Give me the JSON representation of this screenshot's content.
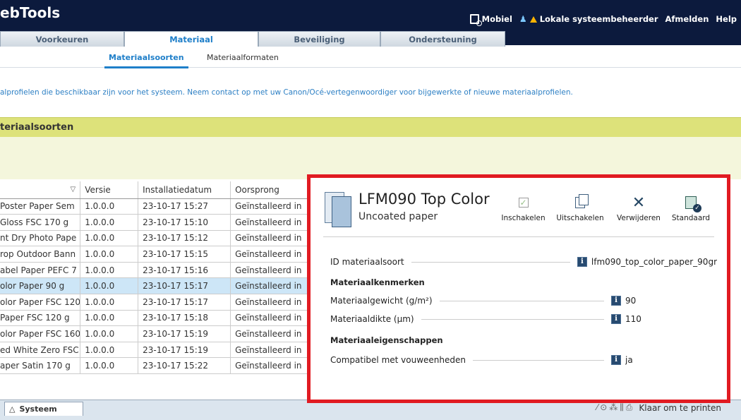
{
  "header": {
    "brand": "ebTools",
    "links": {
      "mobile": "Mobiel",
      "admin": "Lokale systeembeheerder",
      "logout": "Afmelden",
      "help": "Help"
    }
  },
  "main_tabs": [
    "Voorkeuren",
    "Materiaal",
    "Beveiliging",
    "Ondersteuning"
  ],
  "sub_tabs": [
    "Materiaalsoorten",
    "Materiaalformaten"
  ],
  "info_text": "alprofielen die beschikbaar zijn voor het systeem. Neem contact op met uw Canon/Océ-vertegenwoordiger voor bijgewerkte of nieuwe materiaalprofielen.",
  "section": {
    "title": "teriaalsoorten"
  },
  "table": {
    "columns": [
      "",
      "Versie",
      "Installatiedatum",
      "Oorsprong"
    ],
    "rows": [
      {
        "name": "Poster Paper Sem",
        "version": "1.0.0.0",
        "date": "23-10-17 15:27",
        "origin": "Geïnstalleerd in"
      },
      {
        "name": "Gloss FSC 170 g",
        "version": "1.0.0.0",
        "date": "23-10-17 15:10",
        "origin": "Geïnstalleerd in"
      },
      {
        "name": "nt Dry Photo Pape",
        "version": "1.0.0.0",
        "date": "23-10-17 15:12",
        "origin": "Geïnstalleerd in"
      },
      {
        "name": "rop Outdoor Bann",
        "version": "1.0.0.0",
        "date": "23-10-17 15:15",
        "origin": "Geïnstalleerd in"
      },
      {
        "name": "abel Paper PEFC 7",
        "version": "1.0.0.0",
        "date": "23-10-17 15:16",
        "origin": "Geïnstalleerd in"
      },
      {
        "name": "olor Paper 90 g",
        "version": "1.0.0.0",
        "date": "23-10-17 15:17",
        "origin": "Geïnstalleerd in"
      },
      {
        "name": "olor Paper FSC 120",
        "version": "1.0.0.0",
        "date": "23-10-17 15:17",
        "origin": "Geïnstalleerd in"
      },
      {
        "name": "Paper FSC 120 g",
        "version": "1.0.0.0",
        "date": "23-10-17 15:18",
        "origin": "Geïnstalleerd in"
      },
      {
        "name": "olor Paper FSC 160",
        "version": "1.0.0.0",
        "date": "23-10-17 15:19",
        "origin": "Geïnstalleerd in"
      },
      {
        "name": "ed White Zero FSC",
        "version": "1.0.0.0",
        "date": "23-10-17 15:19",
        "origin": "Geïnstalleerd in"
      },
      {
        "name": "aper Satin 170 g",
        "version": "1.0.0.0",
        "date": "23-10-17 15:22",
        "origin": "Geïnstalleerd in"
      }
    ],
    "selected_index": 5
  },
  "footer": {
    "system_tab": "Systeem",
    "status": "Klaar om te printen"
  },
  "detail": {
    "title": "LFM090 Top Color",
    "subtitle": "Uncoated paper",
    "actions": {
      "enable": "Inschakelen",
      "disable": "Uitschakelen",
      "delete": "Verwijderen",
      "default": "Standaard"
    },
    "id_label": "ID materiaalsoort",
    "id_value": "lfm090_top_color_paper_90gr",
    "group1": "Materiaalkenmerken",
    "weight_label": "Materiaalgewicht (g/m²)",
    "weight_value": "90",
    "thickness_label": "Materiaaldikte (µm)",
    "thickness_value": "110",
    "group2": "Materiaaleigenschappen",
    "fold_label": "Compatibel met vouweenheden",
    "fold_value": "ja"
  },
  "colors": {
    "header_bg": "#0c1a3d",
    "accent": "#1f7fc9",
    "section_bg": "#dde27a",
    "selected_row": "#cde6f7",
    "highlight_frame": "#e11b22"
  }
}
